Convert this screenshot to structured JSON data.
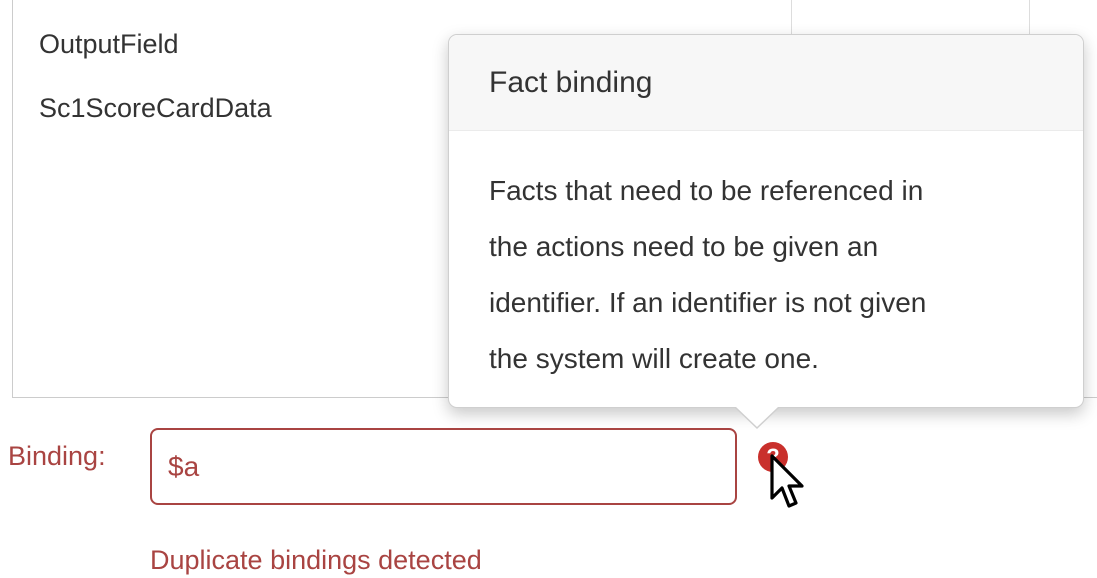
{
  "fact_list": {
    "items": [
      {
        "label": "OutputField"
      },
      {
        "label": "Sc1ScoreCardData"
      }
    ]
  },
  "popover": {
    "title": "Fact binding",
    "content_lines": [
      "Facts that need to be referenced in",
      "the actions need to be given an",
      "identifier. If an identifier is not given",
      "the system will create one."
    ]
  },
  "binding": {
    "label": "Binding:",
    "value": "$a",
    "help_icon_glyph": "?",
    "error_message": "Duplicate bindings detected"
  },
  "icons": {
    "help": "question-circle-icon",
    "cursor": "mouse-pointer-icon"
  },
  "colors": {
    "error": "#a94442",
    "help_icon_bg": "#c9302c",
    "text": "#333333",
    "popover_title_bg": "#f7f7f7"
  }
}
